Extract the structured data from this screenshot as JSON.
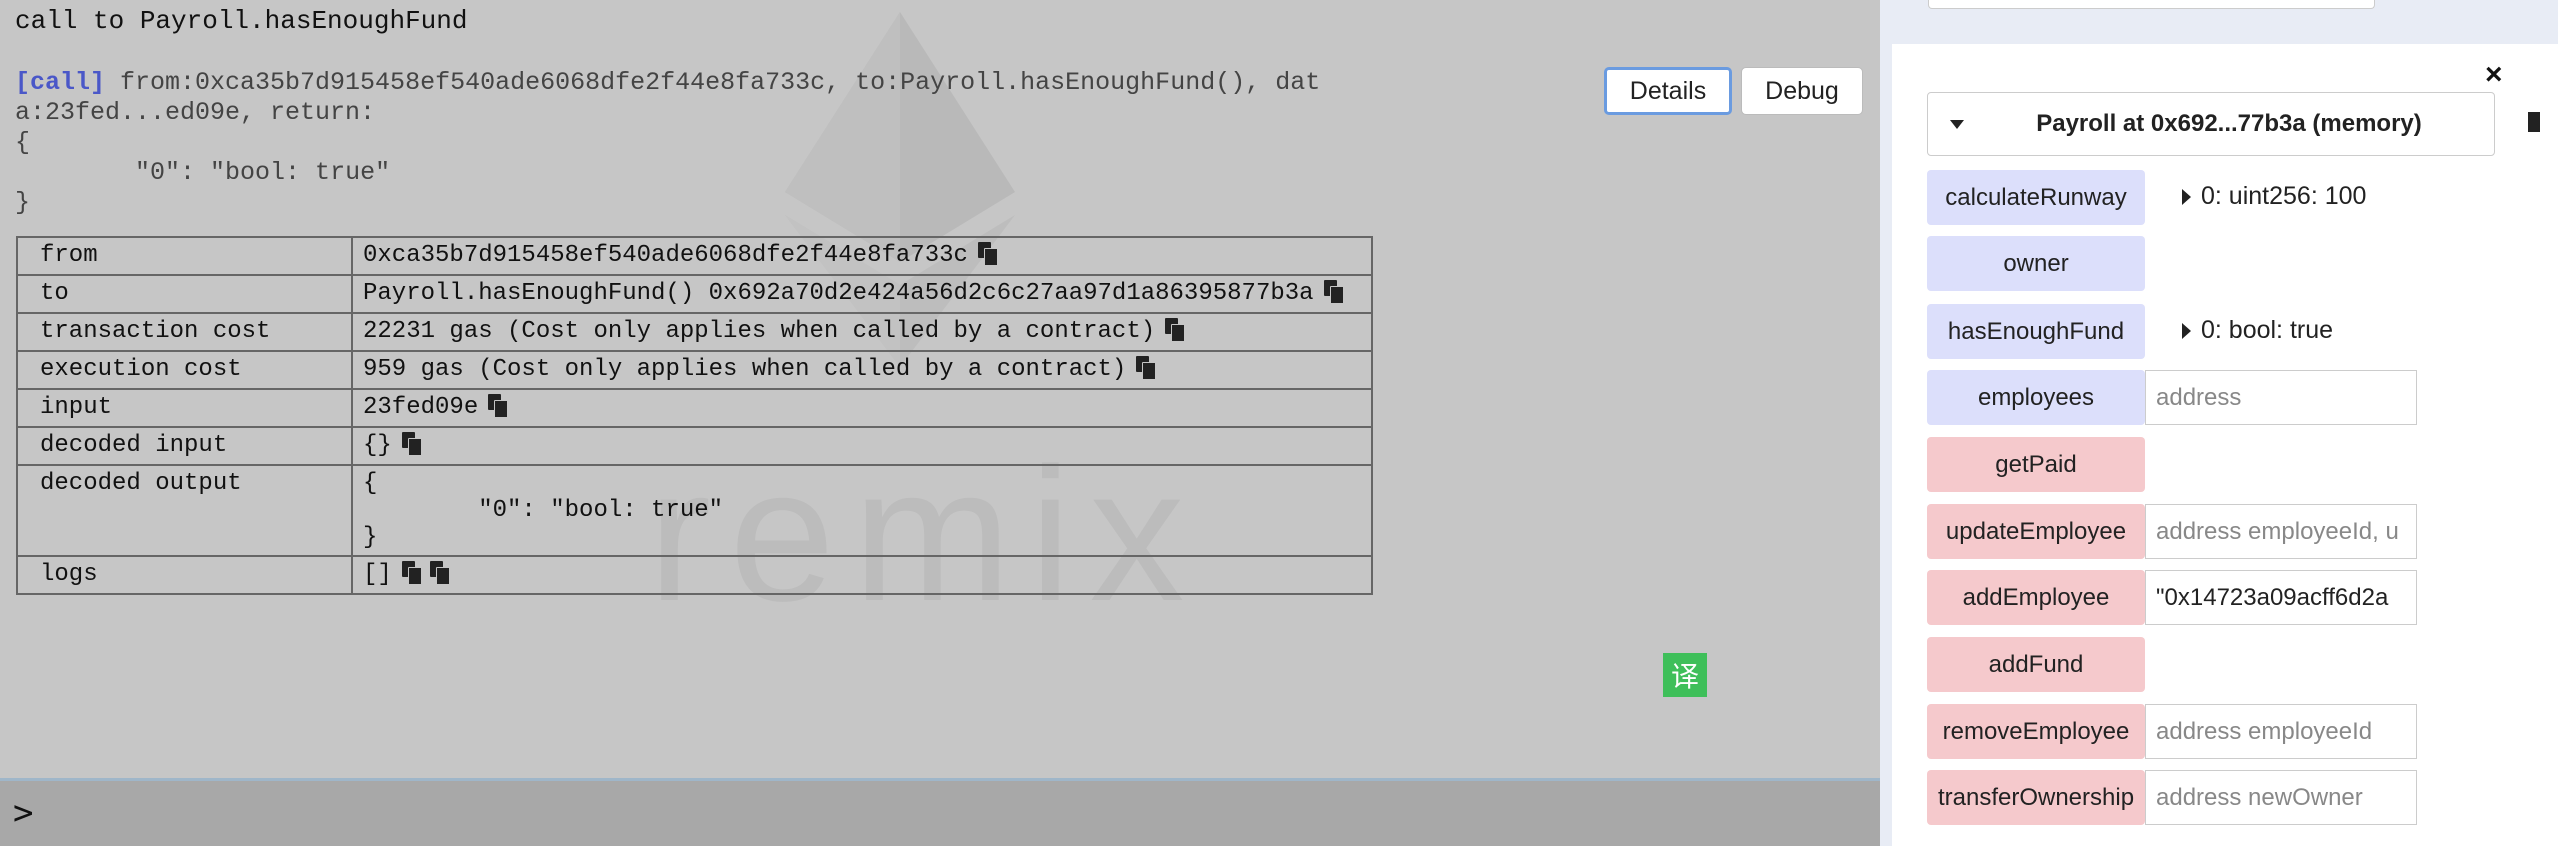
{
  "terminal": {
    "call_title": "call to Payroll.hasEnoughFund",
    "call_tag": "[call]",
    "call_text": " from:0xca35b7d915458ef540ade6068dfe2f44e8fa733c, to:Payroll.hasEnoughFund(), dat\na:23fed...ed09e, return:\n{\n\t\"0\": \"bool: true\"\n}",
    "details_label": "Details",
    "debug_label": "Debug",
    "watermark": "remix",
    "prompt": ">",
    "translate_badge": "译",
    "table": {
      "from_key": "from",
      "from_val": "0xca35b7d915458ef540ade6068dfe2f44e8fa733c",
      "to_key": "to",
      "to_val": "Payroll.hasEnoughFund() 0x692a70d2e424a56d2c6c27aa97d1a86395877b3a",
      "tx_cost_key": "transaction cost",
      "tx_cost_val": "22231 gas (Cost only applies when called by a contract)",
      "exec_cost_key": "execution cost",
      "exec_cost_val": "959 gas (Cost only applies when called by a contract)",
      "input_key": "input",
      "input_val": "23fed09e",
      "decoded_input_key": "decoded input",
      "decoded_input_val": "{}",
      "decoded_output_key": "decoded output",
      "decoded_output_val": "{\n\t\"0\": \"bool: true\"\n}",
      "logs_key": "logs",
      "logs_val": "[]"
    }
  },
  "panel": {
    "close": "×",
    "instance_title": "Payroll at 0x692...77b3a (memory)",
    "functions": [
      {
        "label": "calculateRunway",
        "result": "0: uint256: 100"
      },
      {
        "label": "owner"
      },
      {
        "label": "hasEnoughFund",
        "result": "0: bool: true"
      },
      {
        "label": "employees",
        "placeholder": "address"
      },
      {
        "label": "getPaid"
      },
      {
        "label": "updateEmployee",
        "placeholder": "address employeeId, u"
      },
      {
        "label": "addEmployee",
        "value": "\"0x14723a09acff6d2a"
      },
      {
        "label": "addFund"
      },
      {
        "label": "removeEmployee",
        "placeholder": "address employeeId"
      },
      {
        "label": "transferOwnership",
        "placeholder": "address newOwner"
      }
    ]
  },
  "colors": {
    "terminal_bg": "#c6c6c6",
    "call_tag": "#4a57c8",
    "call_button": "#dcdffb",
    "transact_button": "#f5c9cc",
    "badge": "#3fbf5a"
  }
}
